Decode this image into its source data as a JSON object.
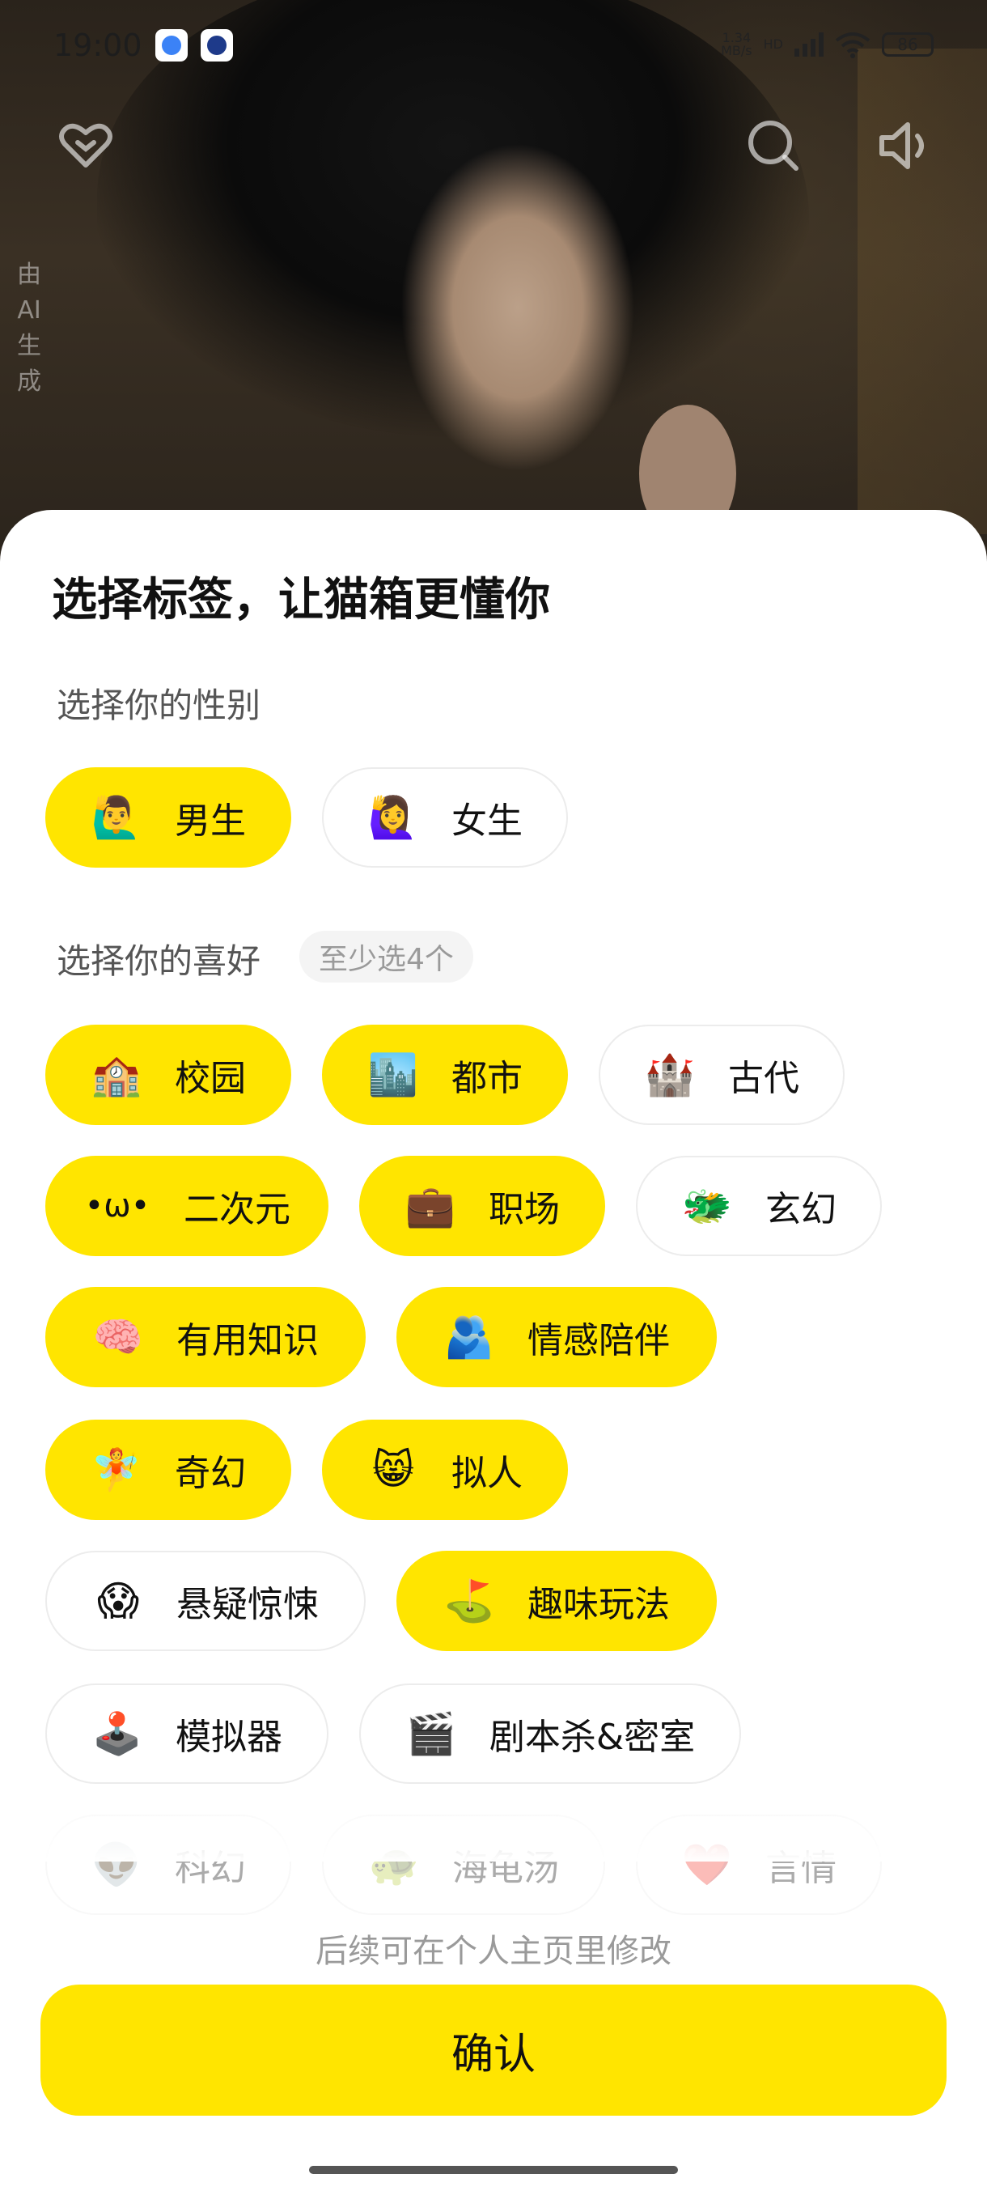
{
  "status_bar": {
    "time": "19:00",
    "net_speed_value": "1.34",
    "net_speed_unit": "MB/s",
    "network_type": "HD",
    "battery": "86"
  },
  "overlay": {
    "ai_label": "由AI生成"
  },
  "sheet": {
    "title": "选择标签，让猫箱更懂你",
    "gender_title": "选择你的性别",
    "genders": [
      {
        "emoji": "🙋‍♂️",
        "label": "男生",
        "selected": true
      },
      {
        "emoji": "🙋‍♀️",
        "label": "女生",
        "selected": false
      }
    ],
    "interest_title": "选择你的喜好",
    "interest_hint": "至少选4个",
    "interests": [
      {
        "emoji": "🏫",
        "label": "校园",
        "selected": true
      },
      {
        "emoji": "🏙️",
        "label": "都市",
        "selected": true
      },
      {
        "emoji": "🏰",
        "label": "古代",
        "selected": false
      },
      {
        "emoji": "•ω•",
        "label": "二次元",
        "selected": true
      },
      {
        "emoji": "💼",
        "label": "职场",
        "selected": true
      },
      {
        "emoji": "🐲",
        "label": "玄幻",
        "selected": false
      },
      {
        "emoji": "🧠",
        "label": "有用知识",
        "selected": true
      },
      {
        "emoji": "🫂",
        "label": "情感陪伴",
        "selected": true
      },
      {
        "emoji": "🧚",
        "label": "奇幻",
        "selected": true
      },
      {
        "emoji": "😸",
        "label": "拟人",
        "selected": true
      },
      {
        "emoji": "😱",
        "label": "悬疑惊悚",
        "selected": false
      },
      {
        "emoji": "⛳",
        "label": "趣味玩法",
        "selected": true
      },
      {
        "emoji": "🕹️",
        "label": "模拟器",
        "selected": false
      },
      {
        "emoji": "🎬",
        "label": "剧本杀&密室",
        "selected": false
      },
      {
        "emoji": "👽",
        "label": "科幻",
        "selected": false
      },
      {
        "emoji": "🐢",
        "label": "海龟汤",
        "selected": false
      },
      {
        "emoji": "❤️",
        "label": "言情",
        "selected": false
      }
    ],
    "footer_note": "后续可在个人主页里修改",
    "confirm_label": "确认"
  },
  "colors": {
    "accent": "#FFE500",
    "chip_border": "#ECECEC",
    "hint_bg": "#F4F4F4",
    "muted_text": "#9A9A9A"
  }
}
